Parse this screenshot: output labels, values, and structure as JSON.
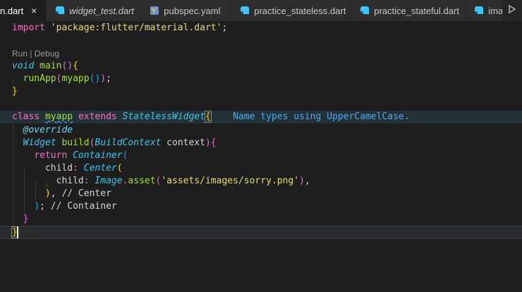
{
  "tabs": [
    {
      "label": "n.dart",
      "active": true,
      "italic": false,
      "icon": "dart-file-icon",
      "close": "×"
    },
    {
      "label": "widget_test.dart",
      "active": false,
      "italic": true,
      "icon": "dart-file-icon"
    },
    {
      "label": "pubspec.yaml",
      "active": false,
      "italic": false,
      "icon": "yaml-file-icon"
    },
    {
      "label": "practice_stateless.dart",
      "active": false,
      "italic": false,
      "icon": "dart-file-icon"
    },
    {
      "label": "practice_stateful.dart",
      "active": false,
      "italic": false,
      "icon": "dart-file-icon"
    },
    {
      "label": "ima",
      "active": false,
      "italic": false,
      "icon": "dart-file-icon"
    }
  ],
  "tab_bar_action": {
    "icon": "run-triangle-icon"
  },
  "code": {
    "line1": {
      "kw": "import",
      "sp": " ",
      "str": "'package:flutter/material.dart'",
      "end": ";"
    },
    "codelens": "Run | Debug",
    "line3": {
      "void": "void",
      "main": " main",
      "paren": "()",
      "brace": "{"
    },
    "line4": {
      "indent": "  ",
      "fn": "runApp",
      "p1": "(",
      "call": "myapp",
      "p2": "()",
      "p3": ")",
      "end": ";"
    },
    "line5": {
      "brace": "}"
    },
    "line7": {
      "class": "class",
      "name": "myapp",
      "extends": "extends",
      "super": "StatelessWidget",
      "brace": "{",
      "hint": "Name types using UpperCamelCase."
    },
    "line8": {
      "indent": "  ",
      "ann": "@override"
    },
    "line9": {
      "indent": "  ",
      "type": "Widget",
      "fn": " build",
      "p1": "(",
      "ptype": "BuildContext",
      "param": " context",
      "p2": ")",
      "brace": "{"
    },
    "line10": {
      "indent": "    ",
      "ret": "return",
      "sp": " ",
      "type": "Container",
      "p": "("
    },
    "line11": {
      "indent": "      ",
      "prop": "child",
      "colon": ": ",
      "type": "Center",
      "p": "("
    },
    "line12": {
      "indent": "        ",
      "prop": "child",
      "colon": ": ",
      "type": "Image",
      "dot": ".",
      "fn": "asset",
      "p1": "(",
      "str": "'assets/images/sorry.png'",
      "p2": ")",
      "end": ","
    },
    "line13": {
      "indent": "      ",
      "p": ")",
      "end": ", ",
      "comment": "// Center"
    },
    "line14": {
      "indent": "    ",
      "p": ")",
      "end": "; ",
      "comment": "// Container"
    },
    "line15": {
      "indent": "  ",
      "brace": "}"
    },
    "line16": {
      "brace": "}"
    }
  }
}
